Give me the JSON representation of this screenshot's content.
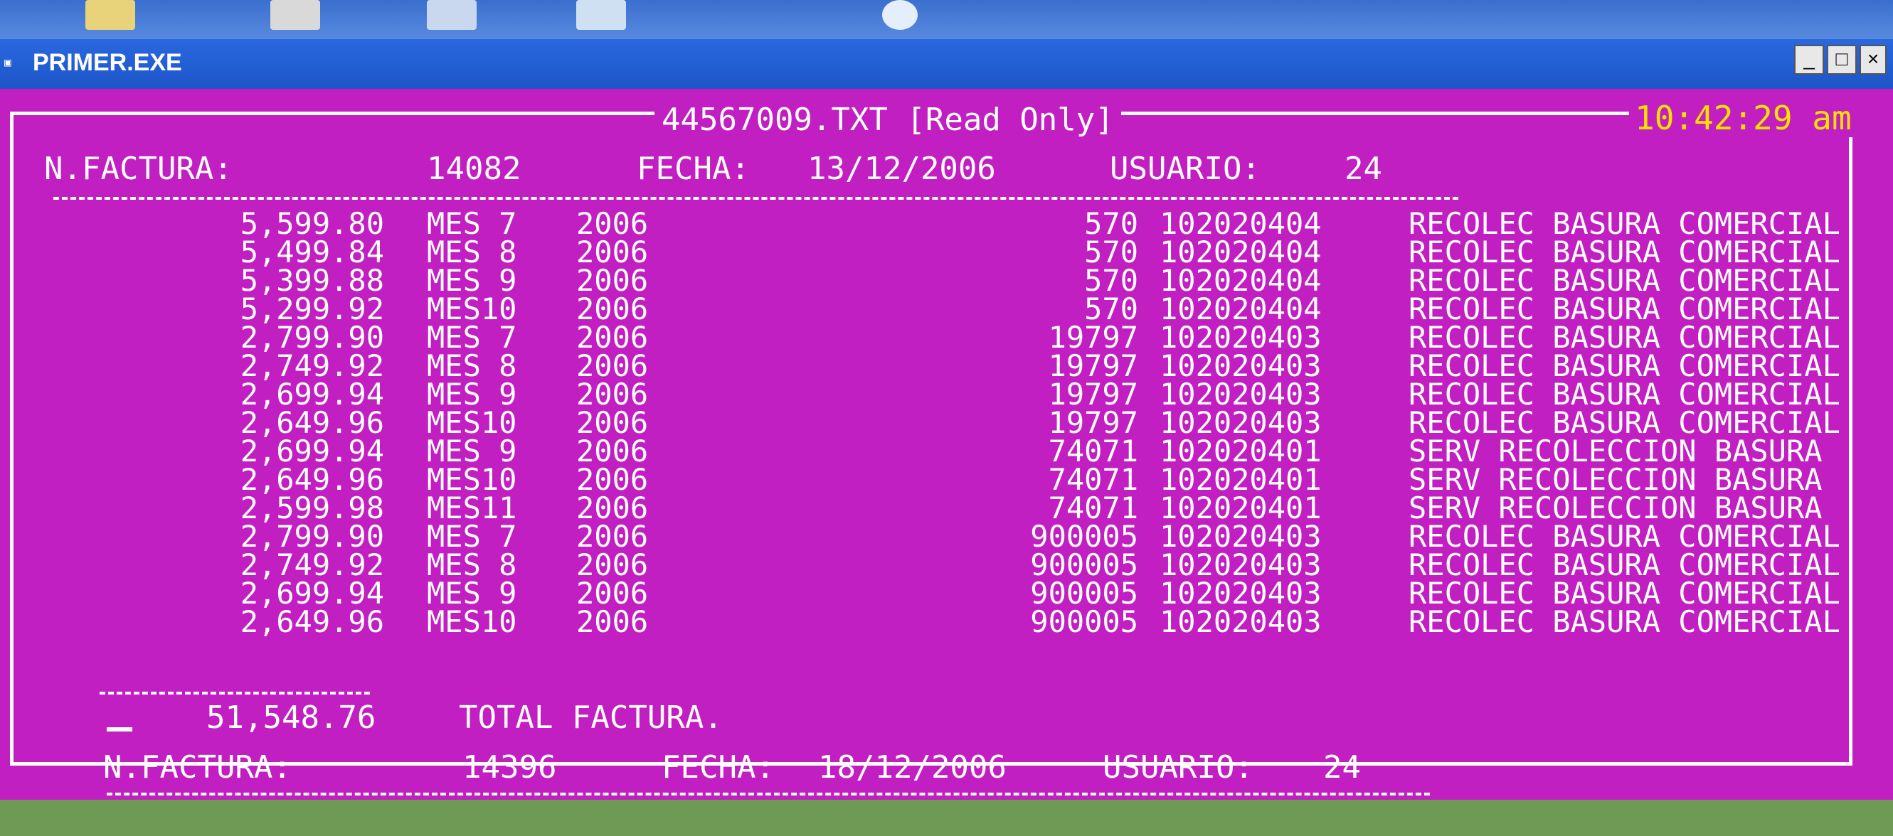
{
  "window": {
    "title": "PRIMER.EXE",
    "icon": "ms-dos-icon",
    "buttons": {
      "minimize": "_",
      "maximize": "□",
      "close": "×"
    }
  },
  "console": {
    "file_title": "44567009.TXT [Read Only]",
    "clock": "10:42:29 am",
    "invoice1": {
      "label": "N.FACTURA:",
      "number": "14082",
      "date_label": "FECHA:",
      "date": "13/12/2006",
      "user_label": "USUARIO:",
      "user": "24"
    },
    "rows": [
      {
        "amount": "5,599.80",
        "mes": "MES 7",
        "year": "2006",
        "code": "570",
        "account": "102020404",
        "desc": "RECOLEC BASURA COMERCIAL"
      },
      {
        "amount": "5,499.84",
        "mes": "MES 8",
        "year": "2006",
        "code": "570",
        "account": "102020404",
        "desc": "RECOLEC BASURA COMERCIAL"
      },
      {
        "amount": "5,399.88",
        "mes": "MES 9",
        "year": "2006",
        "code": "570",
        "account": "102020404",
        "desc": "RECOLEC BASURA COMERCIAL"
      },
      {
        "amount": "5,299.92",
        "mes": "MES10",
        "year": "2006",
        "code": "570",
        "account": "102020404",
        "desc": "RECOLEC BASURA COMERCIAL"
      },
      {
        "amount": "2,799.90",
        "mes": "MES 7",
        "year": "2006",
        "code": "19797",
        "account": "102020403",
        "desc": "RECOLEC BASURA COMERCIAL"
      },
      {
        "amount": "2,749.92",
        "mes": "MES 8",
        "year": "2006",
        "code": "19797",
        "account": "102020403",
        "desc": "RECOLEC BASURA COMERCIAL"
      },
      {
        "amount": "2,699.94",
        "mes": "MES 9",
        "year": "2006",
        "code": "19797",
        "account": "102020403",
        "desc": "RECOLEC BASURA COMERCIAL"
      },
      {
        "amount": "2,649.96",
        "mes": "MES10",
        "year": "2006",
        "code": "19797",
        "account": "102020403",
        "desc": "RECOLEC BASURA COMERCIAL"
      },
      {
        "amount": "2,699.94",
        "mes": "MES 9",
        "year": "2006",
        "code": "74071",
        "account": "102020401",
        "desc": "SERV RECOLECCION BASURA"
      },
      {
        "amount": "2,649.96",
        "mes": "MES10",
        "year": "2006",
        "code": "74071",
        "account": "102020401",
        "desc": "SERV RECOLECCION BASURA"
      },
      {
        "amount": "2,599.98",
        "mes": "MES11",
        "year": "2006",
        "code": "74071",
        "account": "102020401",
        "desc": "SERV RECOLECCION BASURA"
      },
      {
        "amount": "2,799.90",
        "mes": "MES 7",
        "year": "2006",
        "code": "900005",
        "account": "102020403",
        "desc": "RECOLEC BASURA COMERCIAL"
      },
      {
        "amount": "2,749.92",
        "mes": "MES 8",
        "year": "2006",
        "code": "900005",
        "account": "102020403",
        "desc": "RECOLEC BASURA COMERCIAL"
      },
      {
        "amount": "2,699.94",
        "mes": "MES 9",
        "year": "2006",
        "code": "900005",
        "account": "102020403",
        "desc": "RECOLEC BASURA COMERCIAL"
      },
      {
        "amount": "2,649.96",
        "mes": "MES10",
        "year": "2006",
        "code": "900005",
        "account": "102020403",
        "desc": "RECOLEC BASURA COMERCIAL"
      }
    ],
    "total": {
      "amount": "51,548.76",
      "label": "TOTAL FACTURA."
    },
    "invoice2": {
      "label": "N.FACTURA:",
      "number": "14396",
      "date_label": "FECHA:",
      "date": "18/12/2006",
      "user_label": "USUARIO:",
      "user": "24"
    }
  },
  "colors": {
    "console_bg": "#c21fc2",
    "text": "#ffffff",
    "clock": "#ffe000",
    "titlebar": "#1f5fd6"
  }
}
